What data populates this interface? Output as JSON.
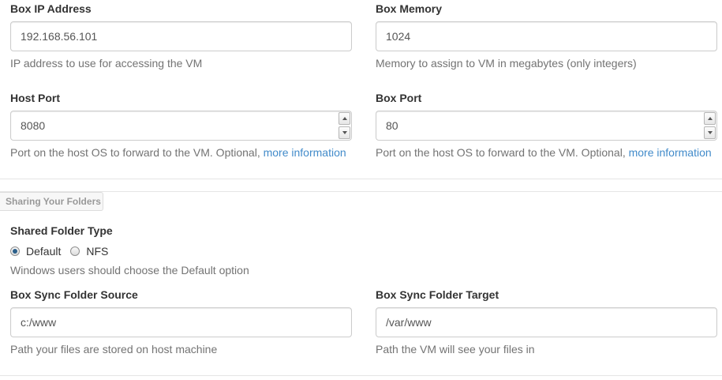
{
  "box_ip": {
    "label": "Box IP Address",
    "value": "192.168.56.101",
    "help": "IP address to use for accessing the VM"
  },
  "box_memory": {
    "label": "Box Memory",
    "value": "1024",
    "help": "Memory to assign to VM in megabytes (only integers)"
  },
  "host_port": {
    "label": "Host Port",
    "value": "8080",
    "help": "Port on the host OS to forward to the VM. Optional,",
    "link": "more information"
  },
  "box_port": {
    "label": "Box Port",
    "value": "80",
    "help": "Port on the host OS to forward to the VM. Optional,",
    "link": "more information"
  },
  "sharing_section": {
    "title": "Sharing Your Folders"
  },
  "shared_folder_type": {
    "label": "Shared Folder Type",
    "options": [
      "Default",
      "NFS"
    ],
    "selected": "Default",
    "help": "Windows users should choose the Default option"
  },
  "sync_source": {
    "label": "Box Sync Folder Source",
    "value": "c:/www",
    "help": "Path your files are stored on host machine"
  },
  "sync_target": {
    "label": "Box Sync Folder Target",
    "value": "/var/www",
    "help": "Path the VM will see your files in"
  },
  "colors": {
    "link": "#428bca",
    "help_text": "#737373",
    "label_text": "#333333",
    "border": "#cccccc"
  }
}
